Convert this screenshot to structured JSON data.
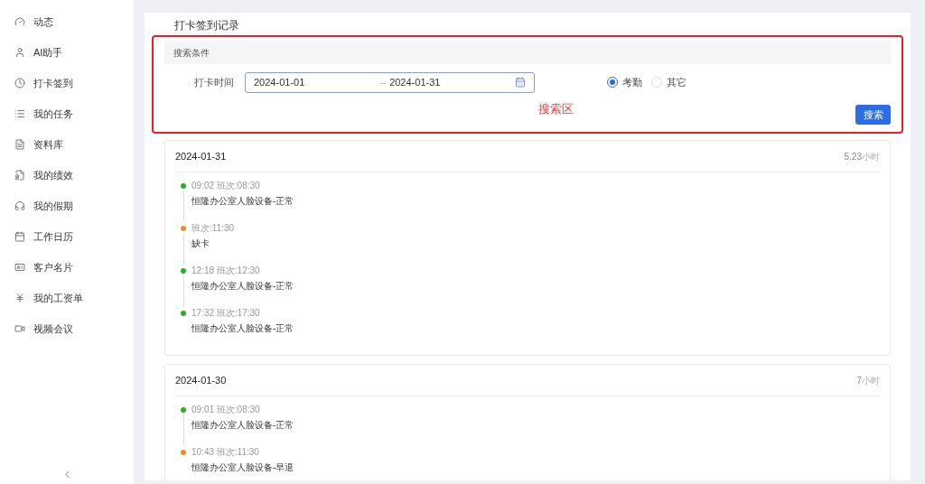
{
  "sidebar": {
    "items": [
      {
        "label": "动态",
        "selected": false
      },
      {
        "label": "AI助手",
        "selected": false
      },
      {
        "label": "打卡签到",
        "selected": false
      },
      {
        "label": "我的任务",
        "selected": false
      },
      {
        "label": "资料库",
        "selected": false
      },
      {
        "label": "我的绩效",
        "selected": false
      },
      {
        "label": "我的假期",
        "selected": false
      },
      {
        "label": "工作日历",
        "selected": false
      },
      {
        "label": "客户名片",
        "selected": false
      },
      {
        "label": "我的工资单",
        "selected": false
      },
      {
        "label": "视频会议",
        "selected": false
      }
    ]
  },
  "page_title": "打卡签到记录",
  "search": {
    "header": "搜索条件",
    "field_label": "打卡时间",
    "start_date": "2024-01-01",
    "separator": "–",
    "end_date": "2024-01-31",
    "options": [
      {
        "label": "考勤",
        "selected": true
      },
      {
        "label": "其它",
        "selected": false
      }
    ],
    "annotation": "搜索区",
    "button": "搜索"
  },
  "records": [
    {
      "date": "2024-01-31",
      "hours": "5.23",
      "hours_unit": "小时",
      "entries": [
        {
          "time": "09:02 班次:08:30",
          "detail": "恒隆办公室人脸设备-正常",
          "color": "#22b322"
        },
        {
          "time": "班次:11:30",
          "detail": "缺卡",
          "color": "#f5892a"
        },
        {
          "time": "12:18 班次:12:30",
          "detail": "恒隆办公室人脸设备-正常",
          "color": "#22b322"
        },
        {
          "time": "17:32 班次:17:30",
          "detail": "恒隆办公室人脸设备-正常",
          "color": "#22b322"
        }
      ]
    },
    {
      "date": "2024-01-30",
      "hours": "7",
      "hours_unit": "小时",
      "entries": [
        {
          "time": "09:01 班次:08:30",
          "detail": "恒隆办公室人脸设备-正常",
          "color": "#22b322"
        },
        {
          "time": "10:43 班次:11:30",
          "detail": "恒隆办公室人脸设备-早退",
          "color": "#f5892a"
        }
      ]
    }
  ]
}
